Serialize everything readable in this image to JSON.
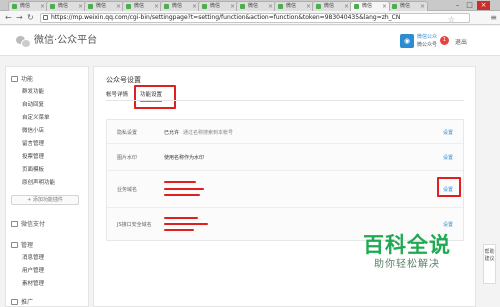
{
  "browser": {
    "tabs": [
      {
        "label": "微信",
        "active": false
      },
      {
        "label": "微信",
        "active": false
      },
      {
        "label": "微信",
        "active": false
      },
      {
        "label": "微信",
        "active": false
      },
      {
        "label": "微信",
        "active": false
      },
      {
        "label": "微信",
        "active": false
      },
      {
        "label": "微信",
        "active": false
      },
      {
        "label": "微信",
        "active": false
      },
      {
        "label": "微信",
        "active": false
      },
      {
        "label": "微信",
        "active": true
      },
      {
        "label": "微信",
        "active": false
      }
    ],
    "url": "https://mp.weixin.qq.com/cgi-bin/settingpage?t=setting/function&action=function&token=983040435&lang=zh_CN",
    "accent": "#4bb04b"
  },
  "header": {
    "logo_text": "微信·公众平台",
    "account_name": "微信公众",
    "account_sub": "微公众号",
    "badge": "1",
    "logout": "退出",
    "avatar_glyph": "◉"
  },
  "sidebar": {
    "groups": [
      {
        "title": "功能",
        "icon": "function-icon",
        "items": [
          "群发功能",
          "自动回复",
          "自定义菜单",
          "微信小店",
          "留言管理",
          "投票管理",
          "页面模板",
          "原创声明功能"
        ]
      },
      {
        "title": "微信支付",
        "icon": "wallet-icon",
        "items": []
      },
      {
        "title": "管理",
        "icon": "manage-icon",
        "items": [
          "消息管理",
          "用户管理",
          "素材管理"
        ]
      },
      {
        "title": "推广",
        "icon": "promotion-icon",
        "items": []
      }
    ],
    "add_plugin": "+ 添加功能插件"
  },
  "main": {
    "title": "公众号设置",
    "tabs": [
      "帐号详情",
      "功能设置"
    ],
    "selected_tab": "功能设置",
    "rows": [
      {
        "label": "隐私设置",
        "value": "已允许",
        "note": "通过名称搜索到本帐号",
        "action": "设置"
      },
      {
        "label": "图片水印",
        "value": "使用名称作为水印",
        "note": "",
        "action": "设置"
      },
      {
        "label": "业务域名",
        "value": "",
        "note": "",
        "action": "设置"
      },
      {
        "label": "JS接口安全域名",
        "value": "",
        "note": "",
        "action": "设置"
      }
    ]
  },
  "float_button": "帮助建议",
  "watermark": {
    "main": "百科全说",
    "sub": "助你轻松解决",
    "color": "#1faa52"
  }
}
